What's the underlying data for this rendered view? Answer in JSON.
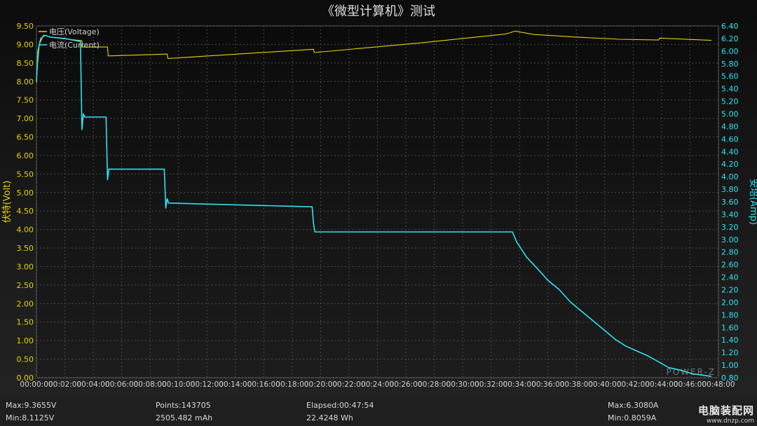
{
  "chart_data": {
    "type": "line",
    "title": "《微型计算机》测试",
    "ylabel_left": "伏特(Volt)",
    "ylabel_right": "安培(Amp)",
    "ylim_left": [
      0,
      9.5
    ],
    "ylim_right": [
      0.8,
      6.4
    ],
    "yticks_left": [
      "0.00",
      "0.50",
      "1.00",
      "1.50",
      "2.00",
      "2.50",
      "3.00",
      "3.50",
      "4.00",
      "4.50",
      "5.00",
      "5.50",
      "6.00",
      "6.50",
      "7.00",
      "7.50",
      "8.00",
      "8.50",
      "9.00",
      "9.50"
    ],
    "yticks_right": [
      "0.80",
      "1.00",
      "1.20",
      "1.40",
      "1.60",
      "1.80",
      "2.00",
      "2.20",
      "2.40",
      "2.60",
      "2.80",
      "3.00",
      "3.20",
      "3.40",
      "3.60",
      "3.80",
      "4.00",
      "4.20",
      "4.40",
      "4.60",
      "4.80",
      "5.00",
      "5.20",
      "5.40",
      "5.60",
      "5.80",
      "6.00",
      "6.20",
      "6.40"
    ],
    "xlim_minutes": [
      0,
      48
    ],
    "xticks": [
      "00:00:00",
      "00:02:00",
      "00:04:00",
      "00:06:00",
      "00:08:00",
      "00:10:00",
      "00:12:00",
      "00:14:00",
      "00:16:00",
      "00:18:00",
      "00:20:00",
      "00:22:00",
      "00:24:00",
      "00:26:00",
      "00:28:00",
      "00:30:00",
      "00:32:00",
      "00:34:00",
      "00:36:00",
      "00:38:00",
      "00:40:00",
      "00:42:00",
      "00:44:00",
      "00:46:00",
      "00:48:00"
    ],
    "legend": [
      "电压(Voltage)",
      "电流(Current)"
    ],
    "legend_position": "top-left",
    "grid": true,
    "watermark": "POWER-Z",
    "series": [
      {
        "name": "电压(Voltage)",
        "axis": "left",
        "color": "#e6d200",
        "x_minutes": [
          0,
          0.2,
          0.5,
          1,
          2,
          3.2,
          3.25,
          5,
          5.05,
          9.2,
          9.25,
          19.5,
          19.55,
          27,
          33,
          33.7,
          35,
          38,
          41,
          43.8,
          43.85,
          47.5
        ],
        "values": [
          8.1,
          9.0,
          9.25,
          9.2,
          9.15,
          9.1,
          8.93,
          8.93,
          8.69,
          8.74,
          8.62,
          8.87,
          8.78,
          9.04,
          9.28,
          9.36,
          9.27,
          9.2,
          9.14,
          9.12,
          9.17,
          9.11
        ]
      },
      {
        "name": "电流(Current)",
        "axis": "right",
        "color": "#2fe2ee",
        "x_minutes": [
          0,
          0.1,
          0.3,
          0.6,
          1,
          2,
          3.1,
          3.2,
          3.3,
          3.4,
          4.9,
          5.0,
          5.1,
          9.0,
          9.1,
          9.2,
          9.3,
          19.4,
          19.5,
          19.6,
          33.5,
          33.8,
          34.5,
          35.2,
          36,
          36.8,
          37.6,
          38.4,
          39.2,
          40,
          40.8,
          41.5,
          42.3,
          43,
          43.8,
          44.5,
          45.3,
          46.2,
          47.5
        ],
        "values": [
          5.5,
          6.0,
          6.2,
          6.25,
          6.22,
          6.2,
          6.15,
          4.75,
          5.0,
          4.95,
          4.95,
          3.95,
          4.12,
          4.12,
          3.5,
          3.65,
          3.58,
          3.52,
          3.25,
          3.12,
          3.12,
          2.96,
          2.72,
          2.55,
          2.35,
          2.2,
          2.0,
          1.85,
          1.7,
          1.55,
          1.4,
          1.3,
          1.22,
          1.15,
          1.05,
          0.96,
          0.92,
          0.86,
          0.82
        ]
      }
    ]
  },
  "stats": {
    "max_voltage": "Max:9.3655V",
    "min_voltage": "Min:8.1125V",
    "points": "Points:143705",
    "capacity": "2505.482 mAh",
    "elapsed": "Elapsed:00:47:54",
    "energy": "22.4248 Wh",
    "max_current": "Max:6.3080A",
    "min_current": "Min:0.8059A"
  },
  "watermark": {
    "site_name": "电脑装配网",
    "site_url": "www.dnzp.com"
  },
  "colors": {
    "voltage_axis": "#e6d200",
    "current_axis": "#2fe2ee",
    "grid": "#4a4a4a",
    "title": "#dddddd"
  }
}
